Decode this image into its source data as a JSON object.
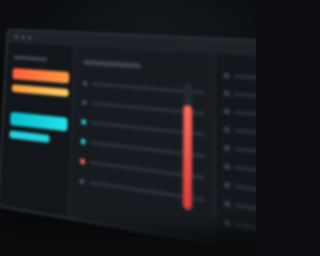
{
  "colors": {
    "background": "#0b0d10",
    "panel": "#15191e",
    "accent_red": "#ff5e3a",
    "accent_orange": "#ff9a3c",
    "accent_teal": "#00c2d1",
    "gauge": "#e23b3b"
  },
  "left_panel": {
    "bands": [
      "red",
      "orange",
      "gap",
      "teal",
      "cyan"
    ]
  },
  "middle_panel": {
    "rows": [
      {
        "icon": "list-item-icon"
      },
      {
        "icon": "list-item-icon"
      },
      {
        "icon": "teal-status-icon"
      },
      {
        "icon": "teal-status-icon"
      },
      {
        "icon": "red-status-icon"
      },
      {
        "icon": "list-item-icon"
      }
    ],
    "gauge_level": 0.82
  },
  "right_panel": {
    "row_count": 9
  }
}
